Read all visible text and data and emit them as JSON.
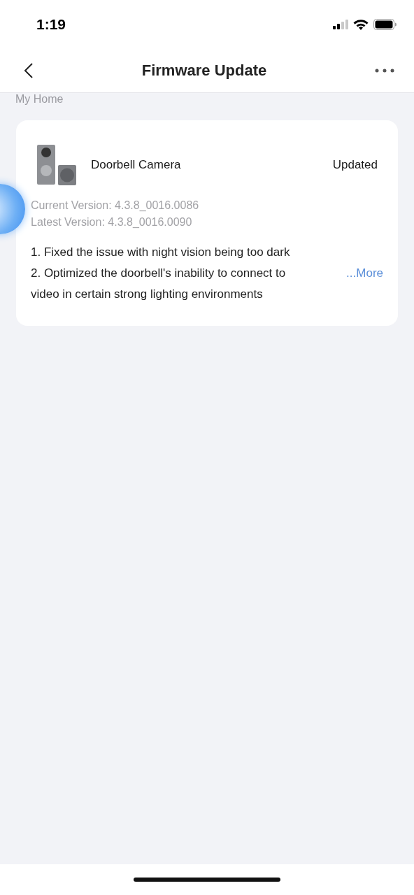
{
  "status_bar": {
    "time": "1:19"
  },
  "nav": {
    "title": "Firmware Update"
  },
  "section_title": "My Home",
  "device": {
    "name": "Doorbell Camera",
    "status": "Updated",
    "current_version": "Current Version: 4.3.8_0016.0086",
    "latest_version": "Latest Version: 4.3.8_0016.0090",
    "notes": [
      "1. Fixed the issue with night vision being too dark",
      "2. Optimized the doorbell's inability to connect to",
      "video in certain strong lighting environments"
    ],
    "more_link": "...More"
  }
}
